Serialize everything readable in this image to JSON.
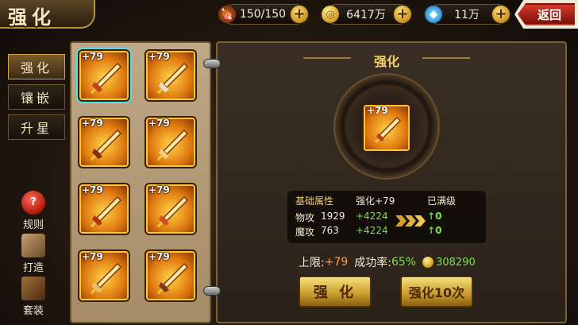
{
  "header": {
    "title": "强化",
    "back_label": "返回",
    "resources": [
      {
        "icon": "meat-icon",
        "value": "150/150"
      },
      {
        "icon": "gold-coin-icon",
        "value": "6417万"
      },
      {
        "icon": "diamond-icon",
        "value": "11万"
      }
    ]
  },
  "menu": {
    "tabs": [
      {
        "label": "强化",
        "active": true
      },
      {
        "label": "镶嵌",
        "active": false
      },
      {
        "label": "升星",
        "active": false
      }
    ],
    "side_buttons": [
      {
        "icon": "question-icon",
        "label": "规则"
      },
      {
        "icon": "forge-icon",
        "label": "打造"
      },
      {
        "icon": "book-icon",
        "label": "套装"
      }
    ]
  },
  "items": [
    {
      "level": "+79",
      "selected": true
    },
    {
      "level": "+79",
      "selected": false
    },
    {
      "level": "+79",
      "selected": false
    },
    {
      "level": "+79",
      "selected": false
    },
    {
      "level": "+79",
      "selected": false
    },
    {
      "level": "+79",
      "selected": false
    },
    {
      "level": "+79",
      "selected": false
    },
    {
      "level": "+79",
      "selected": false
    }
  ],
  "panel": {
    "title": "强化",
    "selected_level": "+79",
    "stats": {
      "header_label": "基础属性",
      "current_label": "强化+79",
      "next_label": "已满级",
      "rows": [
        {
          "name": "物攻",
          "base": "1929",
          "bonus": "+4224",
          "gain": "0"
        },
        {
          "name": "魔攻",
          "base": "763",
          "bonus": "+4224",
          "gain": "0"
        }
      ]
    },
    "limit_label": "上限:",
    "limit_value": "+79",
    "rate_label": "成功率:",
    "rate_value": "65%",
    "cost": "308290",
    "btn_enhance": "强 化",
    "btn_enhance10": "强化10次"
  }
}
